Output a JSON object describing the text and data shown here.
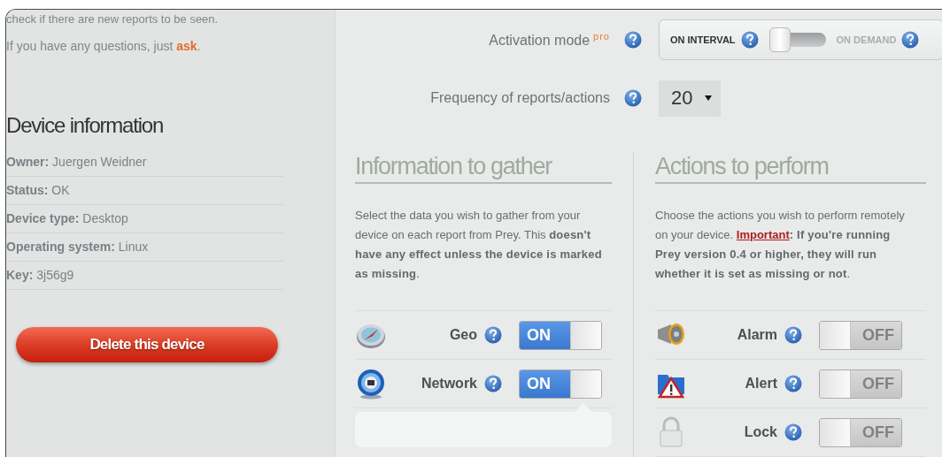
{
  "intro": {
    "first_line": "check if there are new reports to be seen.",
    "question_before": "If you have any questions, just ",
    "question_link": "ask",
    "question_after": "."
  },
  "device_info": {
    "title": "Device information",
    "rows": [
      {
        "label": "Owner:",
        "value": "Juergen Weidner"
      },
      {
        "label": "Status:",
        "value": "OK"
      },
      {
        "label": "Device type:",
        "value": "Desktop"
      },
      {
        "label": "Operating system:",
        "value": "Linux"
      },
      {
        "label": "Key:",
        "value": "3j56g9"
      }
    ]
  },
  "delete_button": "Delete this device",
  "activation_mode": {
    "label": "Activation mode",
    "badge": "pro",
    "options": [
      {
        "label": "ON INTERVAL",
        "selected": true
      },
      {
        "label": "ON DEMAND",
        "selected": false
      }
    ]
  },
  "frequency": {
    "label": "Frequency of reports/actions",
    "value": "20"
  },
  "information": {
    "title": "Information to gather",
    "description": "Select the data you wish to gather from your device on each report from Prey. This **doesn't have any effect unless the device is marked as missing**.",
    "items": [
      {
        "kind": "compass",
        "name": "Geo",
        "on": true,
        "toggle_label": "ON"
      },
      {
        "kind": "network",
        "name": "Network",
        "on": true,
        "toggle_label": "ON"
      }
    ],
    "panel": {
      "kind": "settings"
    }
  },
  "actions": {
    "title": "Actions to perform",
    "description": "Choose the actions you wish to perform remotely on your device. ",
    "important_link": "Important",
    "warning": ": If you're running Prey version 0.4 or higher, they will run whether it is set as missing or not",
    "end": ".",
    "items": [
      {
        "kind": "megaphone",
        "name": "Alarm",
        "on": false,
        "toggle_label": "OFF"
      },
      {
        "kind": "alert",
        "name": "Alert",
        "on": false,
        "toggle_label": "OFF"
      },
      {
        "kind": "lock",
        "name": "Lock",
        "on": false,
        "toggle_label": "OFF"
      }
    ]
  }
}
